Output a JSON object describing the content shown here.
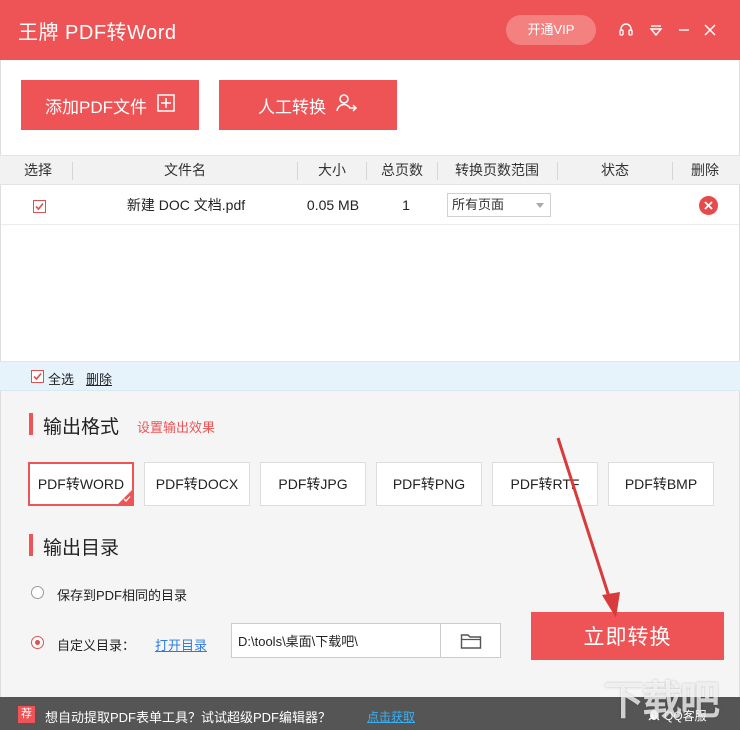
{
  "titlebar": {
    "title": "王牌 PDF转Word",
    "vip_label": "开通VIP",
    "icons": [
      "headset-icon",
      "dropdown-menu-icon",
      "minimize-icon",
      "close-icon"
    ]
  },
  "toolbar": {
    "add_pdf_label": "添加PDF文件",
    "manual_convert_label": "人工转换"
  },
  "table": {
    "headers": [
      "选择",
      "文件名",
      "大小",
      "总页数",
      "转换页数范围",
      "状态",
      "删除"
    ],
    "rows": [
      {
        "selected": true,
        "filename": "新建 DOC 文档.pdf",
        "size": "0.05 MB",
        "pages": "1",
        "range": "所有页面",
        "status": ""
      }
    ]
  },
  "select_bar": {
    "select_all_label": "全选",
    "delete_label": "删除"
  },
  "output_format": {
    "title": "输出格式",
    "settings_link": "设置输出效果",
    "formats": [
      "PDF转WORD",
      "PDF转DOCX",
      "PDF转JPG",
      "PDF转PNG",
      "PDF转RTF",
      "PDF转BMP"
    ],
    "selected": "PDF转WORD"
  },
  "output_dir": {
    "title": "输出目录",
    "same_dir_label": "保存到PDF相同的目录",
    "custom_label": "自定义目录：",
    "open_dir_label": "打开目录",
    "path": "D:\\tools\\桌面\\下载吧\\"
  },
  "convert_button": "立即转换",
  "footer": {
    "badge": "荐",
    "promo_text": "想自动提取PDF表单工具？试试超级PDF编辑器？",
    "promo_link": "点击获取",
    "qq_label": "QQ客服"
  },
  "watermark": "下载吧",
  "colors": {
    "accent": "#ee5456",
    "link": "#2d7be5",
    "footer_bg": "#555555",
    "select_bar_bg": "#e6f3fb"
  }
}
